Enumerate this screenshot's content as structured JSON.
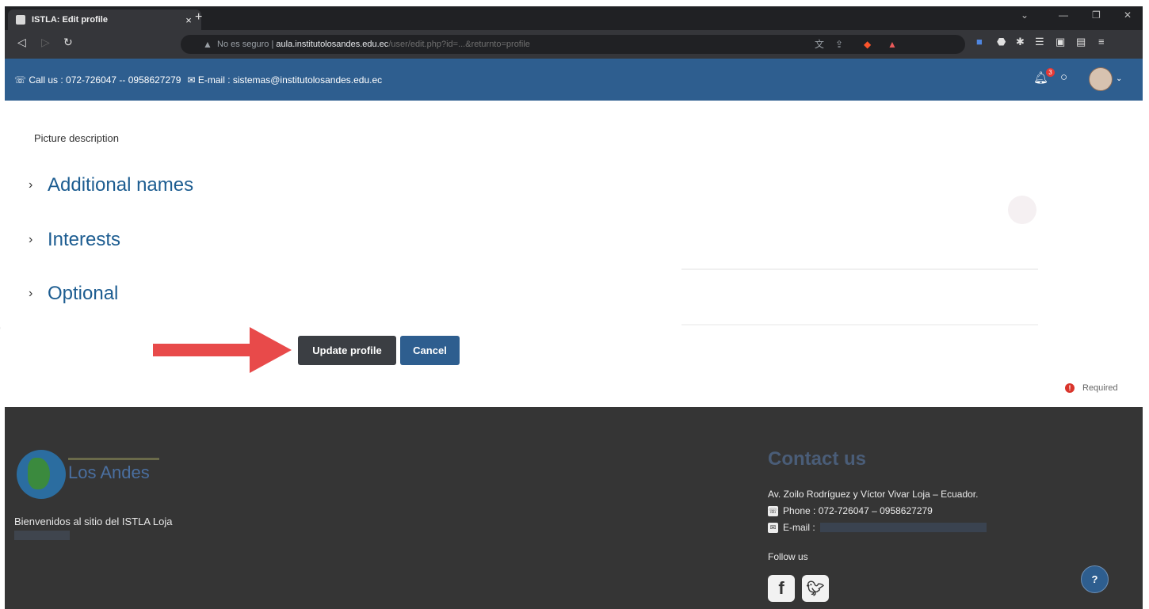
{
  "browser": {
    "tab_title": "ISTLA: Edit profile",
    "tab_close": "×",
    "new_tab": "+",
    "security_warning": "No es seguro",
    "url_host": "aula.institutolosandes.edu.ec",
    "url_path": "/user/edit.php?id=...&returnto=profile"
  },
  "header": {
    "phone": "Call us : 072-726047 -- 0958627279",
    "email": "E-mail : sistemas@institutolosandes.edu.ec",
    "notification_count": "3"
  },
  "form": {
    "picture_description_label": "Picture description",
    "sections": [
      {
        "label": "Additional names"
      },
      {
        "label": "Interests"
      },
      {
        "label": "Optional"
      }
    ],
    "update_button": "Update profile",
    "cancel_button": "Cancel",
    "required_label": "Required"
  },
  "footer": {
    "logo_text": "Los Andes",
    "welcome": "Bienvenidos al sitio del ISTLA Loja",
    "contact_title": "Contact us",
    "address": "Av. Zoilo Rodríguez y Víctor Vivar Loja – Ecuador.",
    "phone": "Phone : 072-726047 – 0958627279",
    "email_label": "E-mail :",
    "follow": "Follow us",
    "help": "?"
  },
  "colors": {
    "header_blue": "#2e5e8f",
    "link_blue": "#1d5d91",
    "footer_bg": "#353535",
    "arrow_red": "#e84a4a"
  }
}
